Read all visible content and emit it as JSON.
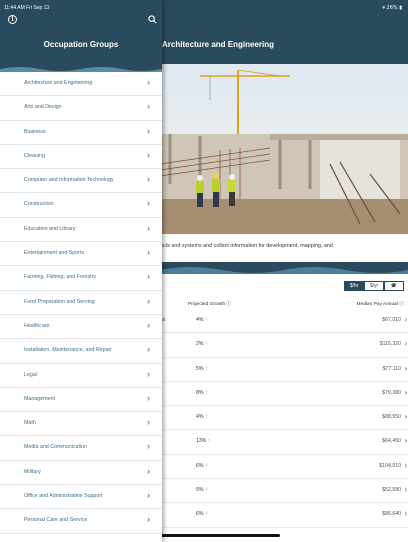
{
  "status_bar": {
    "time": "11:44 AM  Fri Sep 13",
    "indicators": "▾ 26% ▮"
  },
  "sidebar": {
    "title": "Occupation Groups",
    "info_icon": "info-icon",
    "search_icon": "search-icon",
    "items": [
      {
        "label": "Architecture and Engineering"
      },
      {
        "label": "Arts and Design"
      },
      {
        "label": "Business"
      },
      {
        "label": "Cleaning"
      },
      {
        "label": "Computer and Information Technology"
      },
      {
        "label": "Construction"
      },
      {
        "label": "Education and Library"
      },
      {
        "label": "Entertainment and Sports"
      },
      {
        "label": "Farming, Fishing, and Forestry"
      },
      {
        "label": "Food Preparation and Serving"
      },
      {
        "label": "Healthcare"
      },
      {
        "label": "Installation, Maintenance, and Repair"
      },
      {
        "label": "Legal"
      },
      {
        "label": "Management"
      },
      {
        "label": "Math"
      },
      {
        "label": "Media and Communication"
      },
      {
        "label": "Military"
      },
      {
        "label": "Office and Administrative Support"
      },
      {
        "label": "Personal Care and Service"
      }
    ]
  },
  "detail": {
    "title": "Architecture and Engineering",
    "description": "ucts and systems and collect information for development, mapping, and",
    "toggles": [
      "$/hr",
      "$/yr",
      "🎓"
    ],
    "table": {
      "growth_header": "Projected Growth ⓘ",
      "pay_header": "Median Pay Annual ⓘ",
      "left_fragment": "ns",
      "rows": [
        {
          "growth": "4%",
          "pay": "$67,010"
        },
        {
          "growth": "2%",
          "pay": "$115,320"
        },
        {
          "growth": "5%",
          "pay": "$77,110"
        },
        {
          "growth": "8%",
          "pay": "$79,380"
        },
        {
          "growth": "4%",
          "pay": "$88,550"
        },
        {
          "growth": "13%",
          "pay": "$64,450"
        },
        {
          "growth": "6%",
          "pay": "$104,910"
        },
        {
          "growth": "5%",
          "pay": "$52,580"
        },
        {
          "growth": "6%",
          "pay": "$86,640"
        }
      ]
    }
  },
  "colors": {
    "header": "#2a4b5d",
    "accent_link": "#3d6f8e",
    "growth_arrow": "#3aa24a"
  }
}
